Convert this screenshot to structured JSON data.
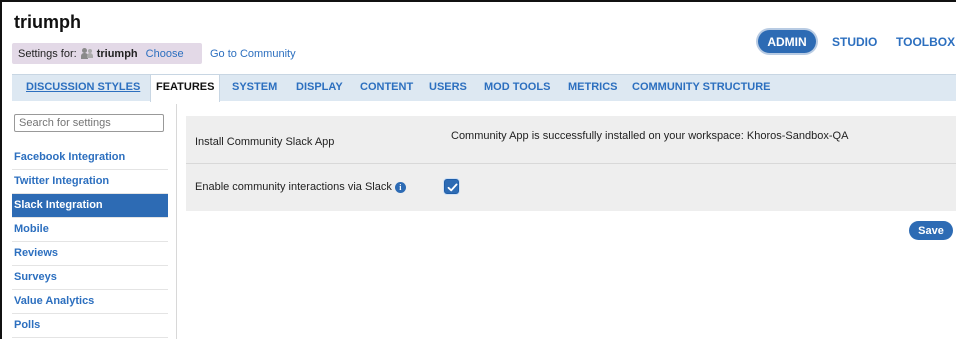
{
  "header": {
    "brand": "triumph",
    "settings_for_label": "Settings for:",
    "community_name": "triumph",
    "choose_label": "Choose",
    "go_to_community": "Go to Community",
    "nav": [
      {
        "label": "ADMIN",
        "active": true
      },
      {
        "label": "STUDIO",
        "active": false
      },
      {
        "label": "TOOLBOX",
        "active": false
      }
    ]
  },
  "tabs": [
    {
      "label": "DISCUSSION STYLES",
      "active": false
    },
    {
      "label": "FEATURES",
      "active": true
    },
    {
      "label": "SYSTEM",
      "active": false
    },
    {
      "label": "DISPLAY",
      "active": false
    },
    {
      "label": "CONTENT",
      "active": false
    },
    {
      "label": "USERS",
      "active": false
    },
    {
      "label": "MOD TOOLS",
      "active": false
    },
    {
      "label": "METRICS",
      "active": false
    },
    {
      "label": "COMMUNITY STRUCTURE",
      "active": false
    }
  ],
  "sidebar": {
    "search_placeholder": "Search for settings",
    "items": [
      {
        "label": "Facebook Integration",
        "active": false
      },
      {
        "label": "Twitter Integration",
        "active": false
      },
      {
        "label": "Slack Integration",
        "active": true
      },
      {
        "label": "Mobile",
        "active": false
      },
      {
        "label": "Reviews",
        "active": false
      },
      {
        "label": "Surveys",
        "active": false
      },
      {
        "label": "Value Analytics",
        "active": false
      },
      {
        "label": "Polls",
        "active": false
      }
    ]
  },
  "main": {
    "install_label": "Install Community Slack App",
    "install_status": "Community App is successfully installed on your workspace: Khoros-Sandbox-QA",
    "enable_label": "Enable community interactions via Slack",
    "enable_checked": true,
    "save_label": "Save"
  },
  "colors": {
    "accent": "#2d6bb4",
    "link": "#2c6fbf",
    "tabbar_bg": "#dde8f2",
    "settings_bar_bg": "#e3d9e7",
    "panel_bg": "#eeeeee"
  },
  "icons": {
    "community": "users-icon",
    "info": "info-icon",
    "check": "checkmark-icon"
  }
}
